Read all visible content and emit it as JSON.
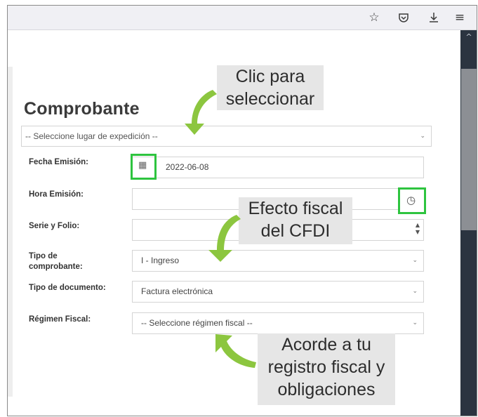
{
  "browser": {
    "icons": [
      "star-icon",
      "pocket-icon",
      "download-icon",
      "menu-icon"
    ]
  },
  "form": {
    "heading": "Comprobante",
    "lugar_placeholder": "-- Seleccione lugar de expedición --",
    "fecha_label": "Fecha Emisión:",
    "fecha_value": "2022-06-08",
    "hora_label": "Hora Emisión:",
    "hora_value": "",
    "serie_label": "Serie y Folio:",
    "serie_value": "",
    "tipo_comprobante_label_1": "Tipo de",
    "tipo_comprobante_label_2": "comprobante:",
    "tipo_comprobante_value": "I - Ingreso",
    "tipo_documento_label": "Tipo de documento:",
    "tipo_documento_value": "Factura electrónica",
    "regimen_label": "Régimen Fiscal:",
    "regimen_value": "-- Seleccione régimen fiscal --"
  },
  "callouts": {
    "clic_1": "Clic para",
    "clic_2": "seleccionar",
    "efecto_1": "Efecto fiscal",
    "efecto_2": "del CFDI",
    "acorde_1": "Acorde a tu",
    "acorde_2": "registro fiscal y",
    "acorde_3": "obligaciones"
  },
  "colors": {
    "highlight": "#2ec43f",
    "arrow_green": "#8cc63f",
    "scrollbar": "#2b3440",
    "callout_bg": "#e6e6e6"
  }
}
